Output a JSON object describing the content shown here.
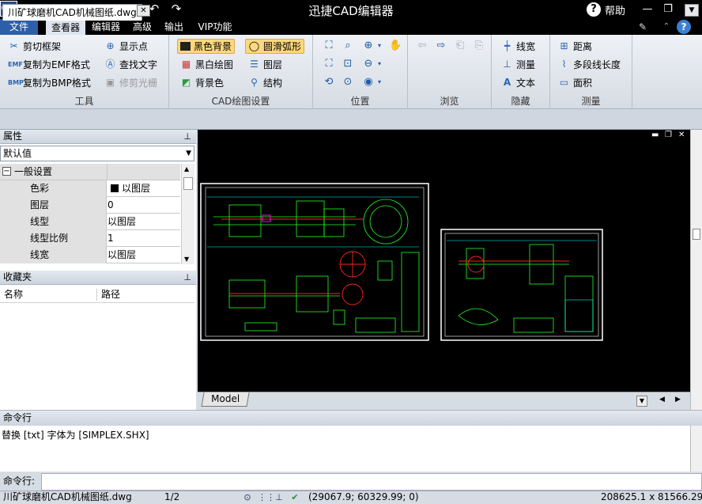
{
  "app": {
    "title": "迅捷CAD编辑器",
    "logo": "CAD",
    "help": "帮助"
  },
  "quick_access": [
    "new-icon",
    "open-icon",
    "save-icon",
    "save-as-icon",
    "print-icon",
    "undo-icon",
    "redo-icon"
  ],
  "window_buttons": [
    "minimize",
    "restore",
    "close"
  ],
  "menu": {
    "tabs": [
      "文件",
      "查看器",
      "编辑器",
      "高级",
      "输出",
      "VIP功能"
    ],
    "active": "查看器"
  },
  "ribbon": {
    "tools": {
      "label": "工具",
      "items": [
        "剪切框架",
        "复制为EMF格式",
        "复制为BMP格式",
        "显示点",
        "查找文字",
        "修剪光栅"
      ]
    },
    "cad_settings": {
      "label": "CAD绘图设置",
      "items": [
        "黑色背景",
        "黑白绘图",
        "背景色",
        "圆滑弧形",
        "图层",
        "结构"
      ]
    },
    "position": {
      "label": "位置"
    },
    "browse": {
      "label": "浏览"
    },
    "hide": {
      "label": "隐藏",
      "items": [
        "线宽",
        "测量",
        "文本"
      ]
    },
    "measure": {
      "label": "测量",
      "items": [
        "距离",
        "多段线长度",
        "面积"
      ]
    }
  },
  "document": {
    "tab": "川矿球磨机CAD机械图纸.dwg"
  },
  "properties": {
    "header": "属性",
    "select": "默认值",
    "group": "一般设置",
    "rows": [
      {
        "key": "色彩",
        "value": "以图层"
      },
      {
        "key": "图层",
        "value": "0"
      },
      {
        "key": "线型",
        "value": "以图层"
      },
      {
        "key": "线型比例",
        "value": "1"
      },
      {
        "key": "线宽",
        "value": "以图层"
      }
    ]
  },
  "favorites": {
    "header": "收藏夹",
    "col_name": "名称",
    "col_path": "路径"
  },
  "canvas": {
    "background": "#000000",
    "model_tab": "Model"
  },
  "command": {
    "header": "命令行",
    "output": "替换 [txt] 字体为 [SIMPLEX.SHX]",
    "input_label": "命令行:"
  },
  "status": {
    "file": "川矿球磨机CAD机械图纸.dwg",
    "page": "1/2",
    "coords": "(29067.9; 60329.99; 0)",
    "size": "208625.1 x 81566.29 x 0"
  }
}
